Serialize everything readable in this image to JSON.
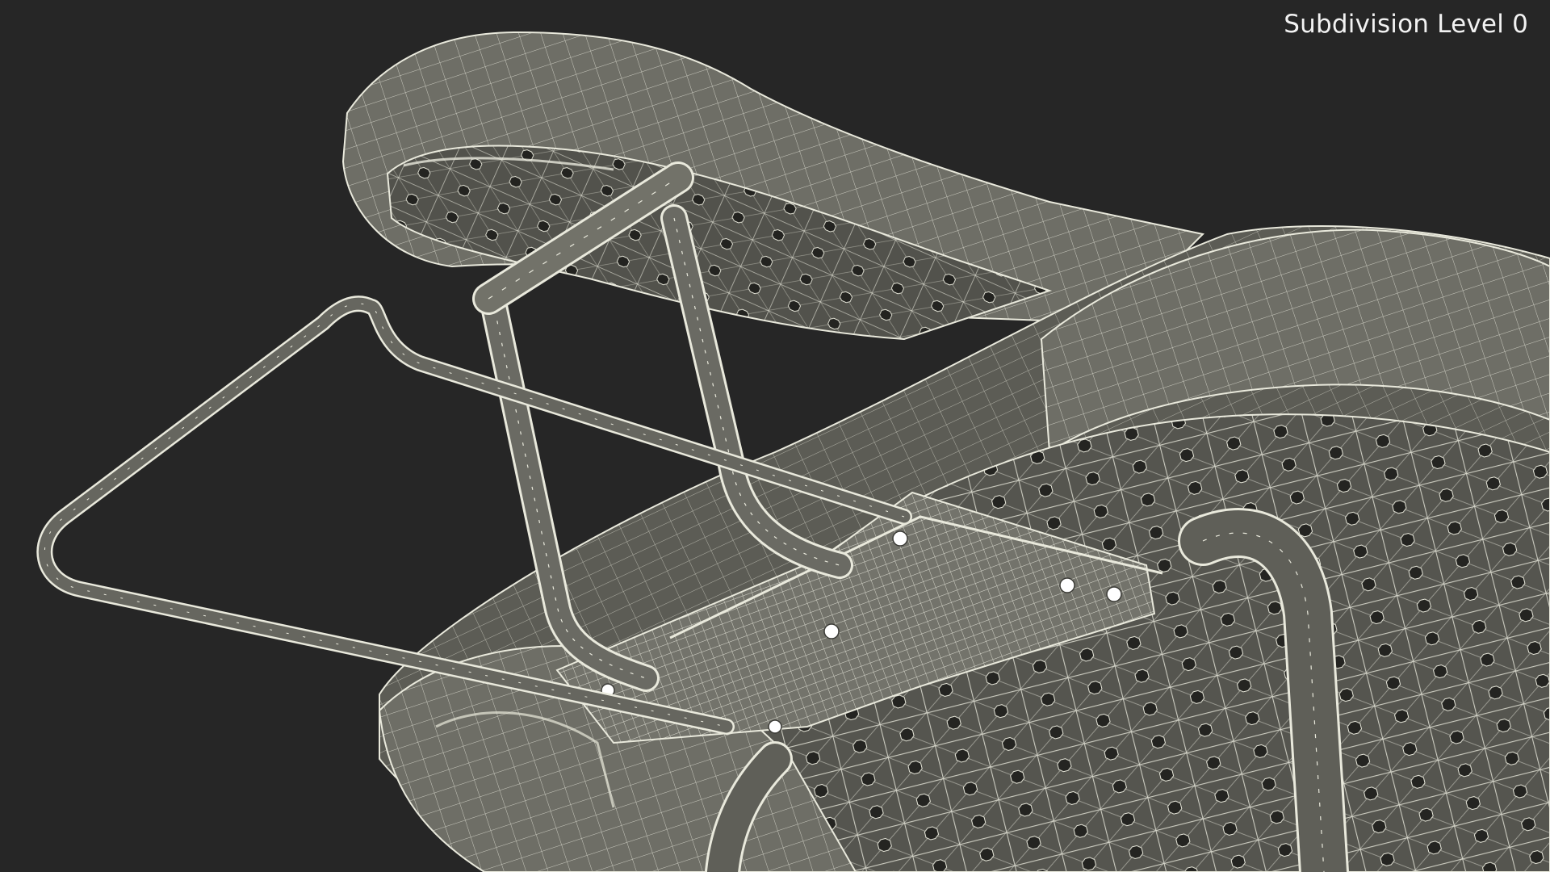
{
  "viewport": {
    "subdivision_label": "Subdivision Level 0",
    "background_color": "#262626",
    "mesh_fill_color": "#6e6e66",
    "mesh_dark_color": "#4c4c46",
    "wire_color": "#e9e9dc"
  },
  "scene": {
    "subject": "ironing board wireframe model"
  }
}
